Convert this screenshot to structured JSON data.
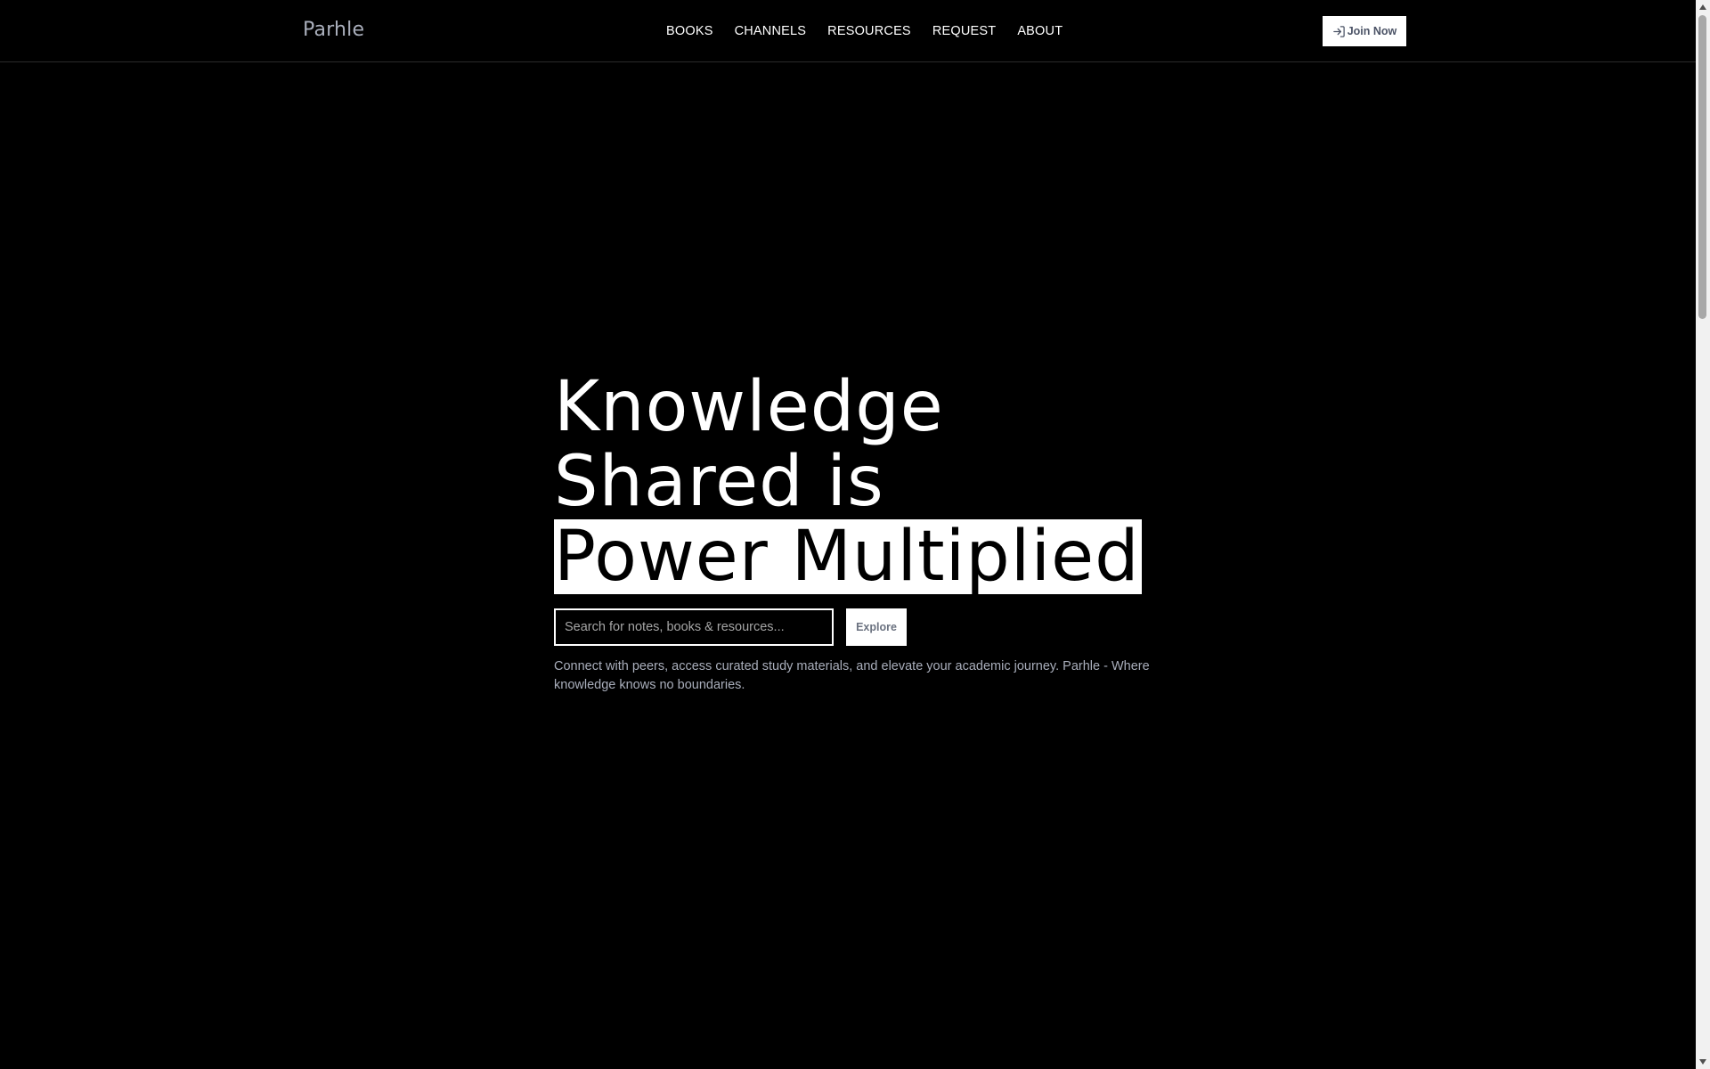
{
  "header": {
    "logo": "Parhle",
    "nav": [
      {
        "label": "BOOKS"
      },
      {
        "label": "CHANNELS"
      },
      {
        "label": "RESOURCES"
      },
      {
        "label": "REQUEST"
      },
      {
        "label": "ABOUT"
      }
    ],
    "join_label": "Join Now",
    "join_icon": "log-in-icon"
  },
  "hero": {
    "headline_line1": "Knowledge",
    "headline_line2": "Shared is",
    "headline_highlight": "Power Multiplied",
    "search_placeholder": "Search for notes, books & resources...",
    "search_value": "",
    "explore_label": "Explore",
    "tagline": "Connect with peers, access curated study materials, and elevate your academic journey. Parhle - Where knowledge knows no boundaries."
  },
  "colors": {
    "background": "#000000",
    "text": "#ffffff",
    "muted_text": "#a9aebb",
    "highlight_bg": "#ffffff",
    "highlight_text": "#000000"
  }
}
